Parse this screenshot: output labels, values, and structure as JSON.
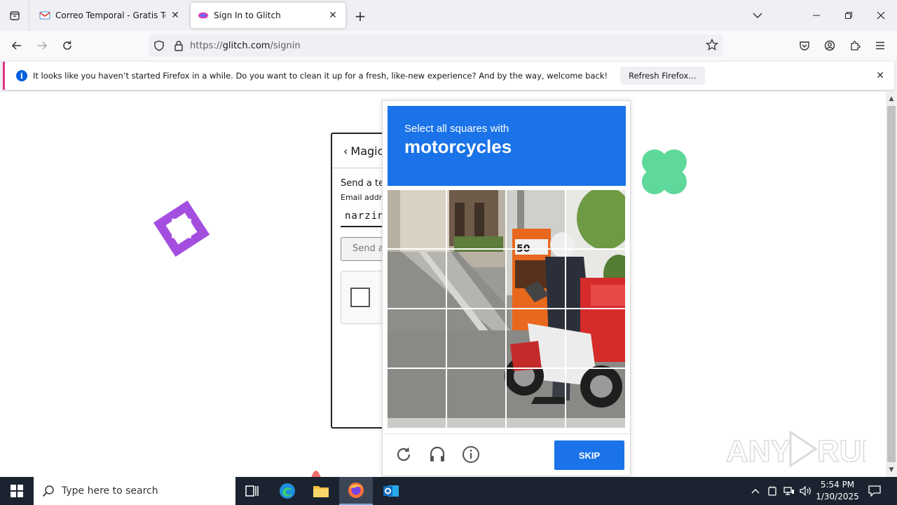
{
  "browser": {
    "tabs": [
      {
        "title": "Correo Temporal - Gratis Temp",
        "active": false,
        "favicon": "gmail-icon"
      },
      {
        "title": "Sign In to Glitch",
        "active": true,
        "favicon": "glitch-icon"
      }
    ],
    "url": {
      "prefix": "https://",
      "domain": "glitch.com",
      "path": "/signin"
    }
  },
  "notification": {
    "message": "It looks like you haven’t started Firefox in a while. Do you want to clean it up for a fresh, like-new experience? And by the way, welcome back!",
    "button": "Refresh Firefox…"
  },
  "glitch": {
    "header": "Magic",
    "send_text": "Send a te",
    "email_label": "Email addr",
    "email_value": "narzin",
    "send_button": "Send a"
  },
  "captcha": {
    "instruction": "Select all squares with",
    "target": "motorcycles",
    "skip_label": "SKIP",
    "grid_size": 4,
    "accent_color": "#1a73e8"
  },
  "taskbar": {
    "search_placeholder": "Type here to search",
    "time": "5:54 PM",
    "date": "1/30/2025"
  },
  "watermark": "ANY RUN"
}
